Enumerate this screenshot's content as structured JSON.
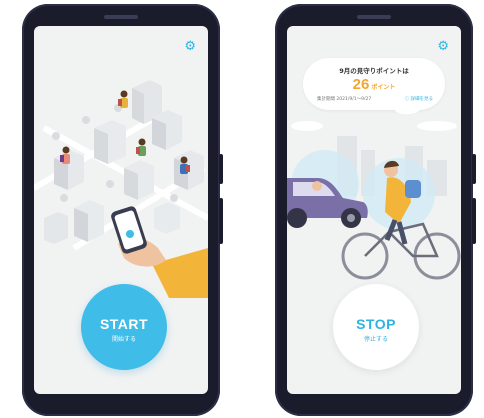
{
  "left_screen": {
    "settings_icon": "gear-icon",
    "button": {
      "label": "START",
      "sub_label": "開始する"
    }
  },
  "right_screen": {
    "settings_icon": "gear-icon",
    "points_card": {
      "title": "9月の見守りポイントは",
      "value": "26",
      "unit": "ポイント",
      "period": "集計期間 2021/9/1〜9/27",
      "link": "詳細を見る"
    },
    "button": {
      "label": "STOP",
      "sub_label": "停止する"
    }
  },
  "colors": {
    "accent": "#3fbce8",
    "points": "#f2a531",
    "phone_body": "#1a1c2c",
    "screen_bg": "#f1f3f3"
  }
}
